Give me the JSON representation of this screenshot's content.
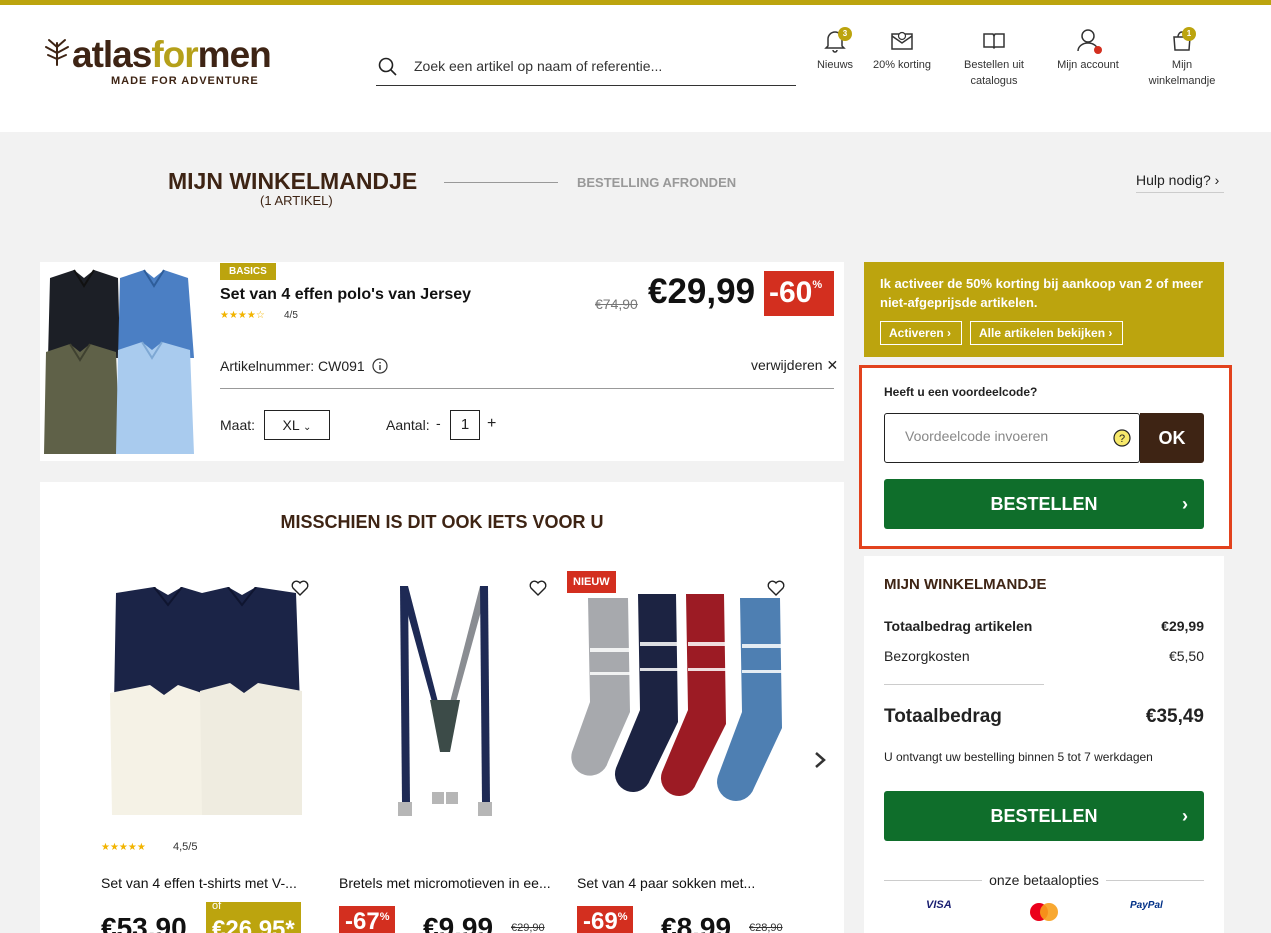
{
  "header": {
    "logo_prefix": "atlas",
    "logo_middle": "for",
    "logo_suffix": "men",
    "logo_tagline": "MADE FOR ADVENTURE",
    "search_placeholder": "Zoek een artikel op naam of referentie...",
    "nav": [
      {
        "label": "Nieuws",
        "icon": "bell-icon",
        "badge": "3"
      },
      {
        "label": "20% korting",
        "icon": "envelope-icon"
      },
      {
        "label_line1": "Bestellen uit",
        "label_line2": "catalogus",
        "icon": "book-icon"
      },
      {
        "label": "Mijn account",
        "icon": "user-icon"
      },
      {
        "label_line1": "Mijn",
        "label_line2": "winkelmandje",
        "icon": "basket-icon",
        "badge": "1"
      }
    ]
  },
  "steps": {
    "current": "MIJN WINKELMANDJE",
    "current_sub": "(1 ARTIKEL)",
    "next": "BESTELLING AFRONDEN",
    "help": "Hulp nodig?"
  },
  "cart_item": {
    "tag": "BASICS",
    "name": "Set van 4 effen polo's van Jersey",
    "rating": "4/5",
    "old_price": "€74,90",
    "price": "€29,99",
    "discount": "-60",
    "discount_unit": "%",
    "article_number": "Artikelnummer: CW091",
    "remove": "verwijderen ✕",
    "size_label": "Maat:",
    "size_value": "XL",
    "qty_label": "Aantal:",
    "qty_minus": "-",
    "qty_value": "1",
    "qty_plus": "+"
  },
  "recommendations": {
    "title": "MISSCHIEN IS DIT OOK IETS VOOR U",
    "items": [
      {
        "name": "Set van 4 effen t-shirts met V-...",
        "rating": "4,5/5",
        "price": "€53,90",
        "alt_prefix": "of",
        "alt_price": "€26,95*"
      },
      {
        "name": "Bretels met micromotieven in ee...",
        "discount": "-67",
        "price": "€9,99",
        "old_price": "€29,90"
      },
      {
        "name": "Set van 4 paar sokken met...",
        "badge": "NIEUW",
        "discount": "-69",
        "price": "€8,99",
        "old_price": "€28,90"
      }
    ]
  },
  "promo": {
    "text": "Ik activeer de 50% korting bij aankoop van 2 of meer niet-afgeprijsde artikelen.",
    "activate": "Activeren",
    "view_all": "Alle artikelen bekijken"
  },
  "voucher": {
    "title": "Heeft u een voordeelcode?",
    "placeholder": "Voordeelcode invoeren",
    "ok": "OK",
    "order": "BESTELLEN"
  },
  "summary": {
    "title": "MIJN WINKELMANDJE",
    "items_label": "Totaalbedrag artikelen",
    "items_value": "€29,99",
    "shipping_label": "Bezorgkosten",
    "shipping_value": "€5,50",
    "total_label": "Totaalbedrag",
    "total_value": "€35,49",
    "delivery_note": "U ontvangt uw bestelling binnen 5 tot 7 werkdagen",
    "order": "BESTELLEN",
    "payment_title": "onze betaalopties",
    "payment_visa": "VISA",
    "payment_paypal": "PayPal"
  },
  "colors": {
    "brand_brown": "#3e2414",
    "brand_gold": "#bca40e",
    "order_green": "#0f6e2b",
    "discount_red": "#d32f1f"
  }
}
